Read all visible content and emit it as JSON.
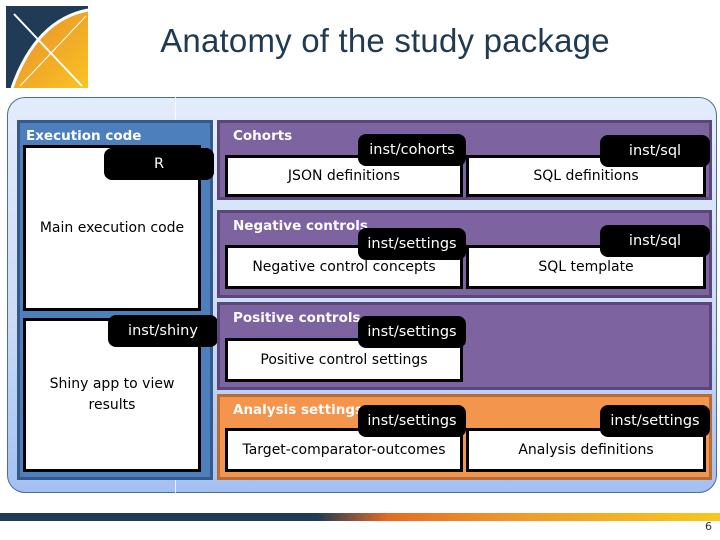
{
  "slide": {
    "title": "Anatomy of the study package",
    "page_number": "6",
    "logo": "ohdsi-logo"
  },
  "colors": {
    "title": "#1f3a52",
    "execution_panel": "#4e7fbd",
    "purple_panel": "#7d63a0",
    "analysis_panel": "#f3954c",
    "tag_bg": "#000000"
  },
  "execution": {
    "title": "Execution code",
    "r_tag": "R",
    "main_box": "Main execution code",
    "shiny_tag": "inst/shiny",
    "shiny_box": "Shiny app to view results"
  },
  "cohorts": {
    "title": "Cohorts",
    "left_tag": "inst/cohorts",
    "left_box": "JSON definitions",
    "right_tag": "inst/sql",
    "right_box": "SQL definitions"
  },
  "negative_controls": {
    "title": "Negative controls",
    "left_tag": "inst/settings",
    "left_box": "Negative control concepts",
    "right_tag": "inst/sql",
    "right_box": "SQL template"
  },
  "positive_controls": {
    "title": "Positive controls",
    "left_tag": "inst/settings",
    "left_box": "Positive control settings"
  },
  "analysis_settings": {
    "title": "Analysis settings",
    "left_tag": "inst/settings",
    "left_box": "Target-comparator-outcomes",
    "right_tag": "inst/settings",
    "right_box": "Analysis definitions"
  }
}
